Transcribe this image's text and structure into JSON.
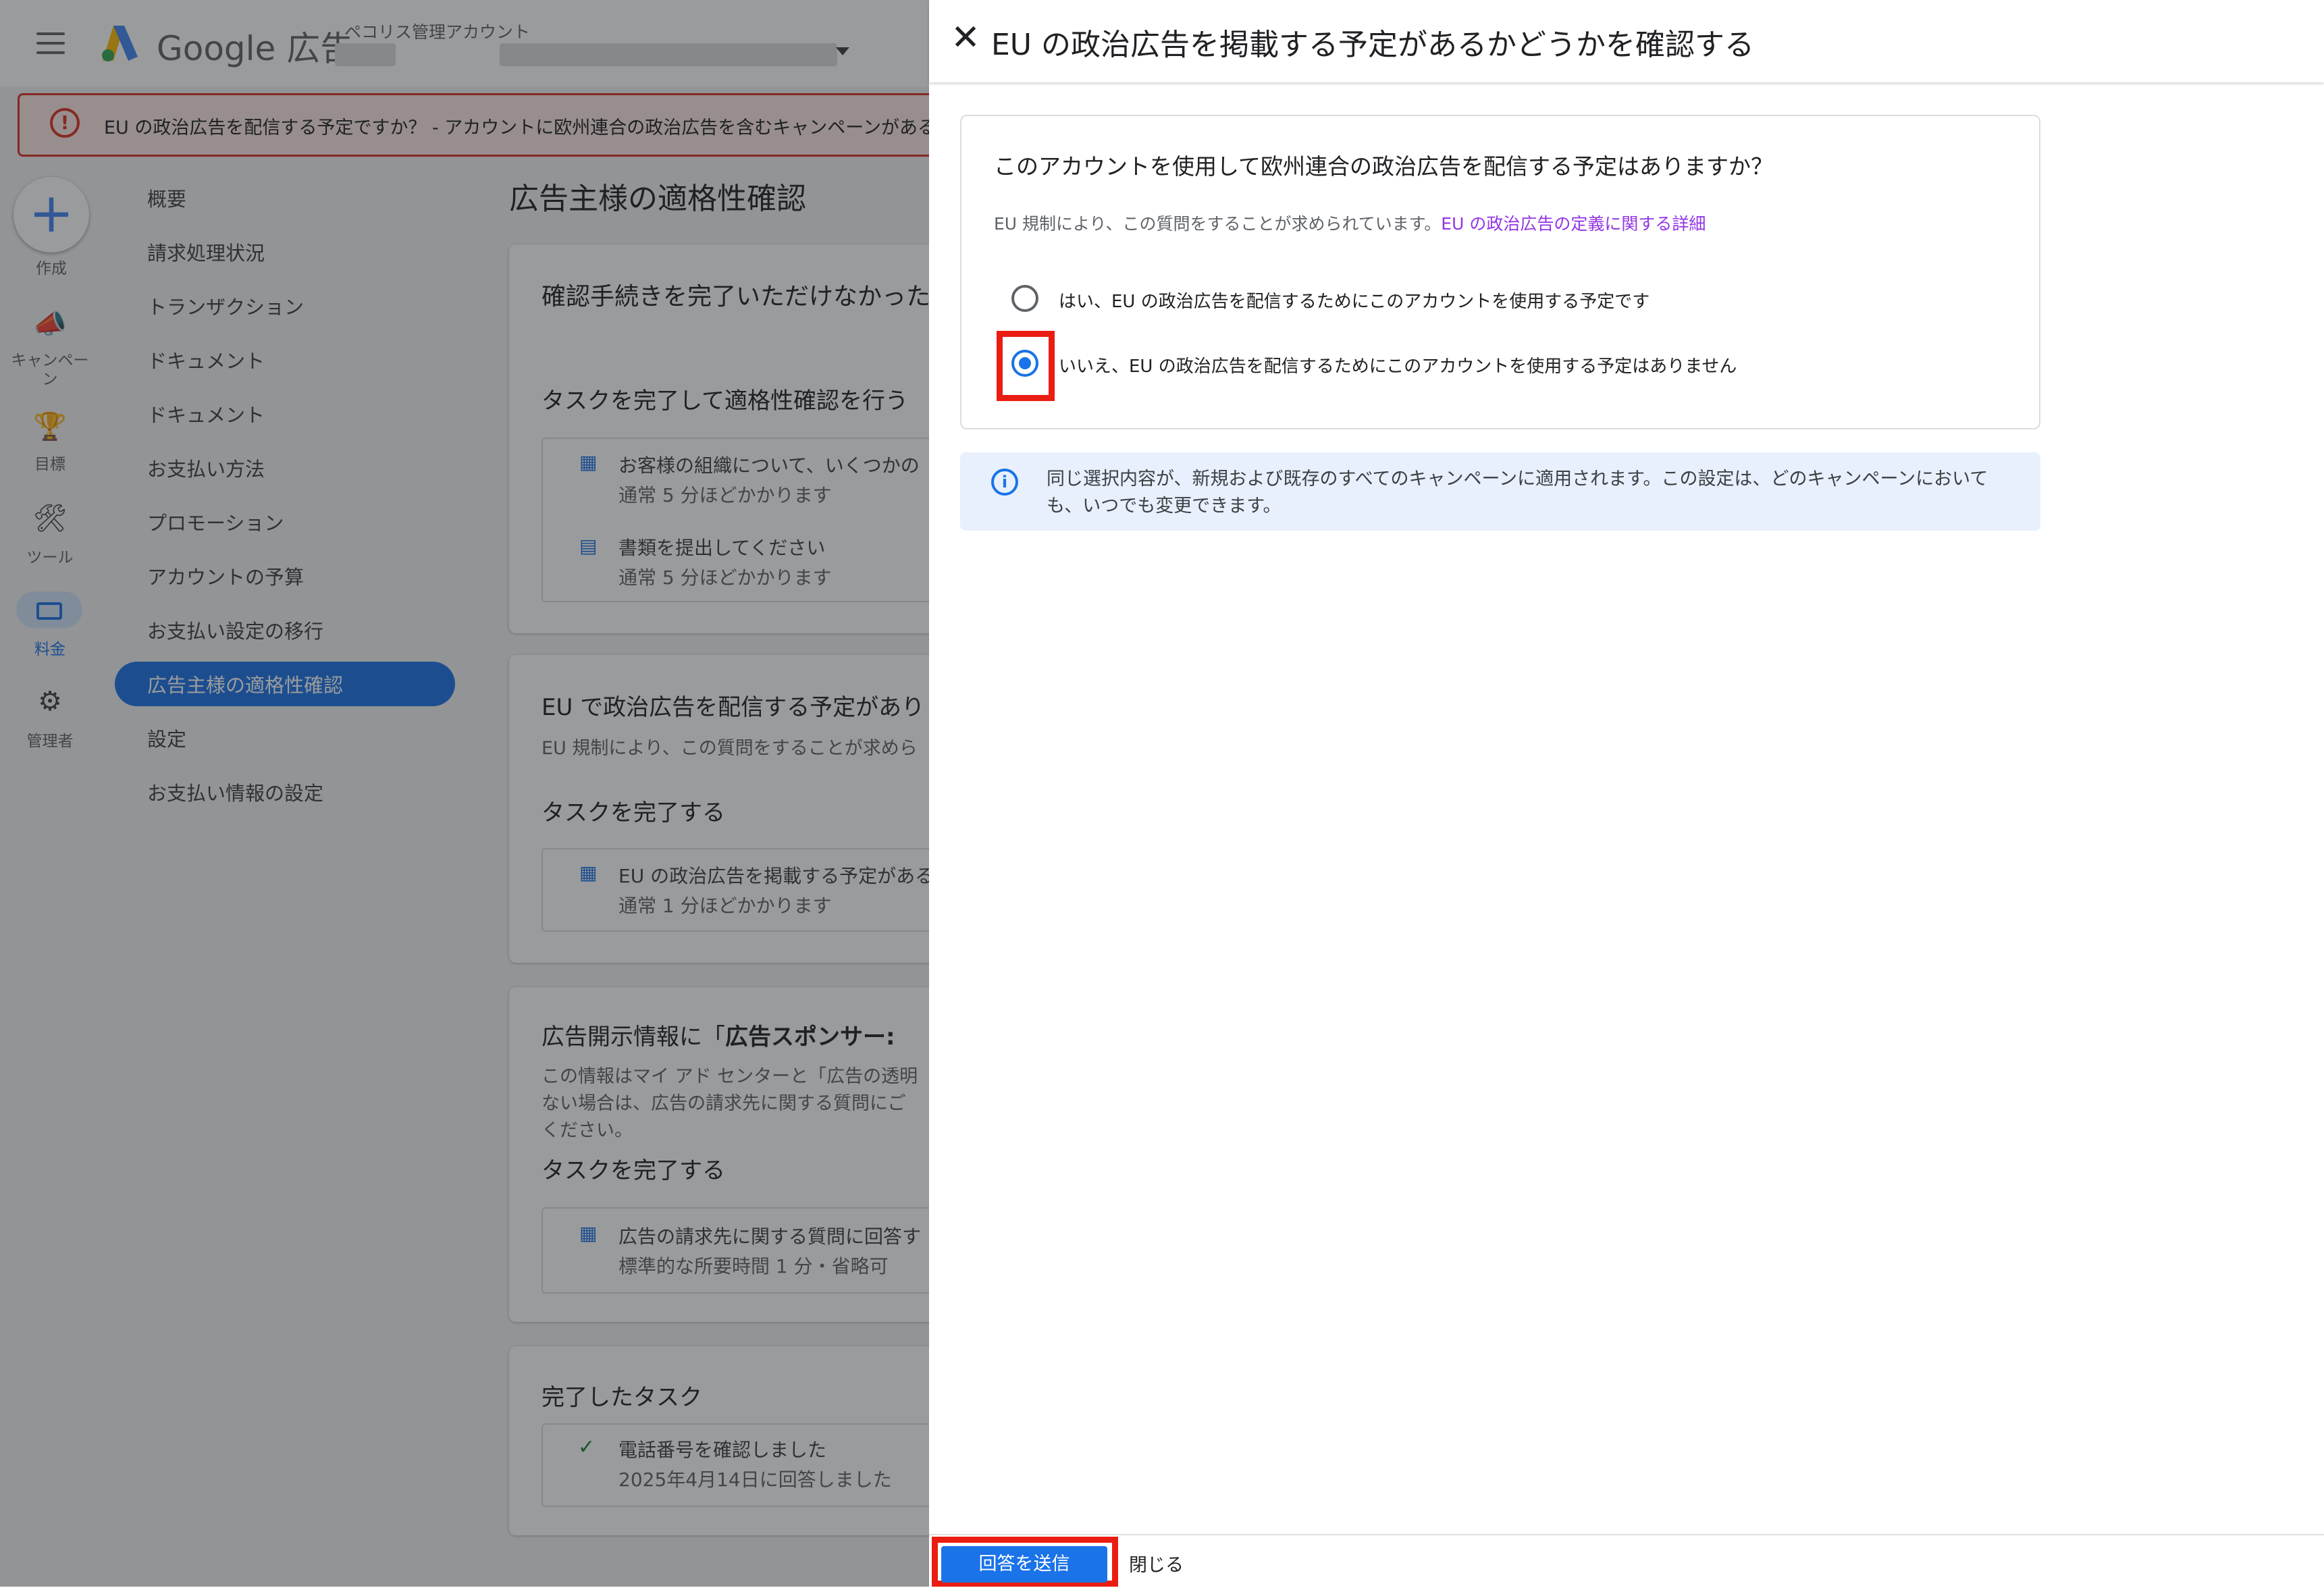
{
  "app": {
    "brand": "Google 広告",
    "account_label": "ペコリス管理アカウント",
    "banner_text": "EU の政治広告を配信する予定ですか？ - アカウントに欧州連合の政治広告を含むキャンペーンがあるかどうかをお知らせください"
  },
  "rail": [
    {
      "label": "作成"
    },
    {
      "label": "キャンペーン"
    },
    {
      "label": "目標"
    },
    {
      "label": "ツール"
    },
    {
      "label": "料金"
    },
    {
      "label": "管理者"
    }
  ],
  "nav": [
    "概要",
    "請求処理状況",
    "トランザクション",
    "ドキュメント",
    "ドキュメント",
    "お支払い方法",
    "プロモーション",
    "アカウントの予算",
    "お支払い設定の移行",
    "広告主様の適格性確認",
    "設定",
    "お支払い情報の設定"
  ],
  "main": {
    "page_title": "広告主様の適格性確認",
    "card1": {
      "heading": "確認手続きを完了いただけなかった",
      "subheading": "タスクを完了して適格性確認を行う",
      "task1_title": "お客様の組織について、いくつかの",
      "task1_time": "通常 5 分ほどかかります",
      "task2_title": "書類を提出してください",
      "task2_time": "通常 5 分ほどかかります"
    },
    "card2": {
      "heading": "EU で政治広告を配信する予定があり",
      "desc": "EU 規制により、この質問をすることが求めら",
      "subheading": "タスクを完了する",
      "task_title": "EU の政治広告を掲載する予定がある",
      "task_time": "通常 1 分ほどかかります"
    },
    "card3": {
      "heading_prefix": "広告開示情報に「",
      "heading_bold": "広告スポンサー: ",
      "desc1": "この情報はマイ アド センターと「広告の透明",
      "desc2": "ない場合は、広告の請求先に関する質問にご",
      "desc3": "ください。",
      "subheading": "タスクを完了する",
      "task_title": "広告の請求先に関する質問に回答す",
      "task_time": "標準的な所要時間 1 分・省略可"
    },
    "card4": {
      "heading": "完了したタスク",
      "task_title": "電話番号を確認しました",
      "task_time": "2025年4月14日に回答しました"
    }
  },
  "panel": {
    "title": "EU の政治広告を掲載する予定があるかどうかを確認する",
    "question": "このアカウントを使用して欧州連合の政治広告を配信する予定はありますか？",
    "reg_note": "EU 規制により、この質問をすることが求められています。",
    "reg_link": "EU の政治広告の定義に関する詳細",
    "option_yes": "はい、EU の政治広告を配信するためにこのアカウントを使用する予定です",
    "option_no": "いいえ、EU の政治広告を配信するためにこのアカウントを使用する予定はありません",
    "selected_option": "option_no",
    "info": "同じ選択内容が、新規および既存のすべてのキャンペーンに適用されます。この設定は、どのキャンペーンにおいても、いつでも変更できます。",
    "submit_label": "回答を送信",
    "close_label": "閉じる"
  },
  "colors": {
    "accent": "#1a73e8",
    "highlight": "#ea1d12",
    "link": "#9334e6",
    "error": "#d93025"
  }
}
